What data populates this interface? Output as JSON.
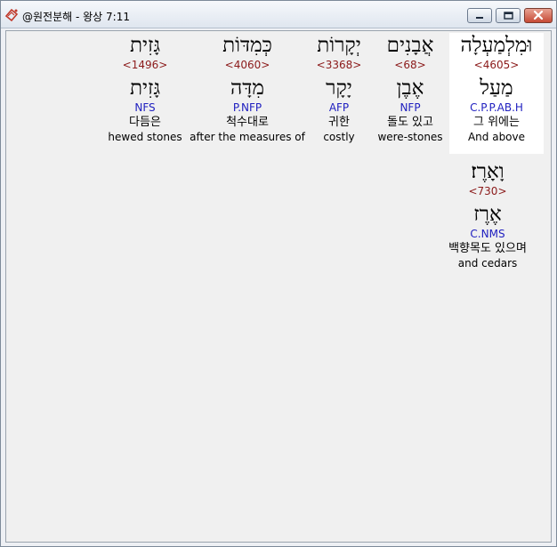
{
  "window": {
    "title": "@원전분해 - 왕상 7:11"
  },
  "words": [
    {
      "hebrew": "וּמִלְמַעְלָה",
      "strong": "<4605>",
      "lemma": "מַעַל",
      "morph": "C.P.P.AB.H",
      "korean": "그 위에는",
      "english": "And above"
    },
    {
      "hebrew": "אֲבָנִים",
      "strong": "<68>",
      "lemma": "אֶבֶן",
      "morph": "NFP",
      "korean": "돌도 있고",
      "english": "were-stones"
    },
    {
      "hebrew": "יְקָרוֹת",
      "strong": "<3368>",
      "lemma": "יָקָר",
      "morph": "AFP",
      "korean": "귀한",
      "english": "costly"
    },
    {
      "hebrew": "כְּמִדּוֹת",
      "strong": "<4060>",
      "lemma": "מִדָּה",
      "morph": "P.NFP",
      "korean": "척수대로",
      "english": "after the measures of"
    },
    {
      "hebrew": "גָּזִית",
      "strong": "<1496>",
      "lemma": "גָּזִית",
      "morph": "NFS",
      "korean": "다듬은",
      "english": "hewed stones"
    },
    {
      "hebrew": "וָאָרֶז׃",
      "strong": "<730>",
      "lemma": "אֶרֶז",
      "morph": "C.NMS",
      "korean": "백향목도 있으며",
      "english": "and cedars"
    }
  ]
}
